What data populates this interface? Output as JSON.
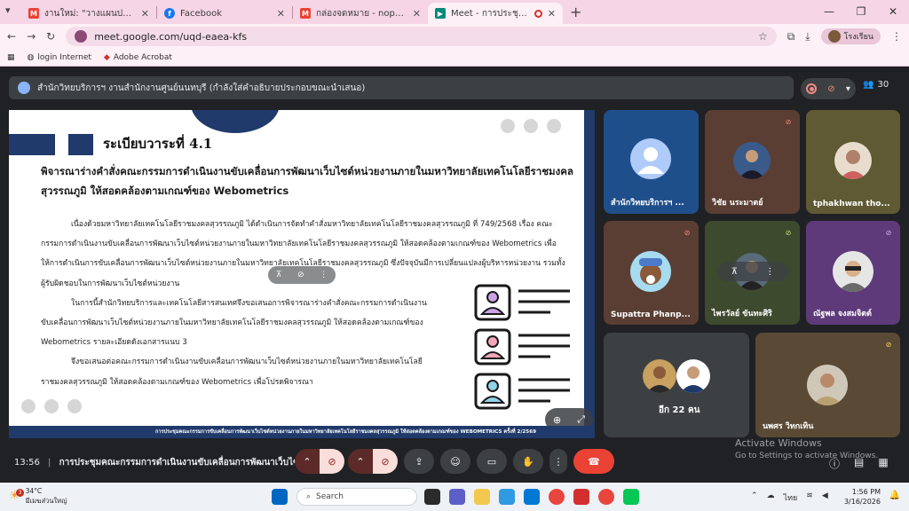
{
  "browser": {
    "tabs": [
      {
        "title": "งานใหม่: \"วางแผนปฏิบัติราชการ 16-...",
        "favicon": "gmail-icon",
        "active": false
      },
      {
        "title": "Facebook",
        "favicon": "facebook-icon",
        "active": false
      },
      {
        "title": "กล่องจดหมาย - noppasorn.w@m...",
        "favicon": "gmail-icon",
        "active": false
      },
      {
        "title": "Meet - การประชุมคณะกรรมการ",
        "favicon": "meet-icon",
        "active": true
      }
    ],
    "new_tab": "+",
    "url": "meet.google.com/uqd-eaea-kfs",
    "profile_label": "โรงเรียน",
    "bookmarks": [
      "login Internet",
      "Adobe Acrobat"
    ]
  },
  "meet": {
    "presenter_banner": "สำนักวิทยบริการฯ งานสำนักงานศูนย์นนทบุรี (กำลังใส่คำอธิบายประกอบขณะนำเสนอ)",
    "participant_count": "30",
    "meeting_time": "13:56",
    "meeting_separator": "|",
    "meeting_title": "การประชุมคณะกรรมการดำเนินงานขับเคลื่อนการพัฒนาเว็บไซ...",
    "tiles": [
      {
        "name": "สำนักวิทยบริการฯ ...",
        "muted": false
      },
      {
        "name": "วิชัย นระมาตย์",
        "muted": true
      },
      {
        "name": "tphakhwan tho...",
        "muted": false
      },
      {
        "name": "Supattra Phanp...",
        "muted": true
      },
      {
        "name": "ไพรวัลย์ ขันทะศิริ",
        "muted": true
      },
      {
        "name": "ณัฐพล จงสมจิตต์",
        "muted": true
      },
      {
        "name": "อีก 22 คน",
        "muted": false
      },
      {
        "name": "นพศร วิทกเทิน",
        "muted": true
      }
    ]
  },
  "slide": {
    "heading": "ระเบียบวาระที่ 4.1",
    "title": "พิจารณาร่างคำสั่งคณะกรรมการดำเนินงานขับเคลื่อนการพัฒนาเว็บไซต์หน่วยงานภายในมหาวิทยาลัยเทคโนโลยีราชมงคลสุวรรณภูมิ ให้สอดคล้องตามเกณฑ์ของ Webometrics",
    "para1": "เนื่องด้วยมหาวิทยาลัยเทคโนโลยีราชมงคลสุวรรณภูมิ ได้ดำเนินการจัดทำคำสั่งมหาวิทยาลัยเทคโนโลยีราชมงคลสุวรรณภูมิ ที่ 749/2568 เรื่อง คณะกรรมการดำเนินงานขับเคลื่อนการพัฒนาเว็บไซต์หน่วยงานภายในมหาวิทยาลัยเทคโนโลยีราชมงคลสุวรรณภูมิ ให้สอดคล้องตามเกณฑ์ของ Webometrics เพื่อให้การดำเนินการขับเคลื่อนการพัฒนาเว็บไซต์หน่วยงานภายในมหาวิทยาลัยเทคโนโลยีราชมงคลสุวรรณภูมิ ซึ่งปัจจุบันมีการเปลี่ยนแปลงผู้บริหารหน่วยงาน รวมทั้งผู้รับผิดชอบในการพัฒนาเว็บไซต์หน่วยงาน",
    "para2": "ในการนี้สำนักวิทยบริการและเทคโนโลยีสารสนเทศจึงขอเสนอการพิจารณาร่างคำสั่งคณะกรรมการดำเนินงานขับเคลื่อนการพัฒนาเว็บไซต์หน่วยงานภายในมหาวิทยาลัยเทคโนโลยีราชมงคลสุวรรณภูมิ ให้สอดคล้องตามเกณฑ์ของ Webometrics รายละเอียดดังเอกสารแนบ 3",
    "para3": "จึงขอเสนอต่อคณะกรรมการดำเนินงานขับเคลื่อนการพัฒนาเว็บไซต์หน่วยงานภายในมหาวิทยาลัยเทคโนโลยีราชมงคลสุวรรณภูมิ ให้สอดคล้องตามเกณฑ์ของ Webometrics เพื่อโปรดพิจารณา",
    "footer": "การประชุมคณะกรรมการขับเคลื่อนการพัฒนาเว็บไซต์หน่วยงานภายในมหาวิทยาลัยเทคโนโลยีราชมงคลสุวรรณภูมิ ให้สอดคล้องตามเกณฑ์ของ WEBOMETRICS ครั้งที่ 2/2569"
  },
  "windows": {
    "activate_title": "Activate Windows",
    "activate_sub": "Go to Settings to activate Windows.",
    "weather_temp": "34°C",
    "weather_desc": "มีเมฆส่วนใหญ่",
    "weather_badge": "3",
    "search_placeholder": "Search",
    "tray_lang": "ไทย",
    "time": "1:56 PM",
    "date": "3/16/2026"
  },
  "colors": {
    "meet_bg": "#202124",
    "slide_navy": "#1f3a6b",
    "end_call_red": "#ea4335",
    "muted_red": "#f28b82",
    "chrome_pink": "#f6d5e6"
  }
}
